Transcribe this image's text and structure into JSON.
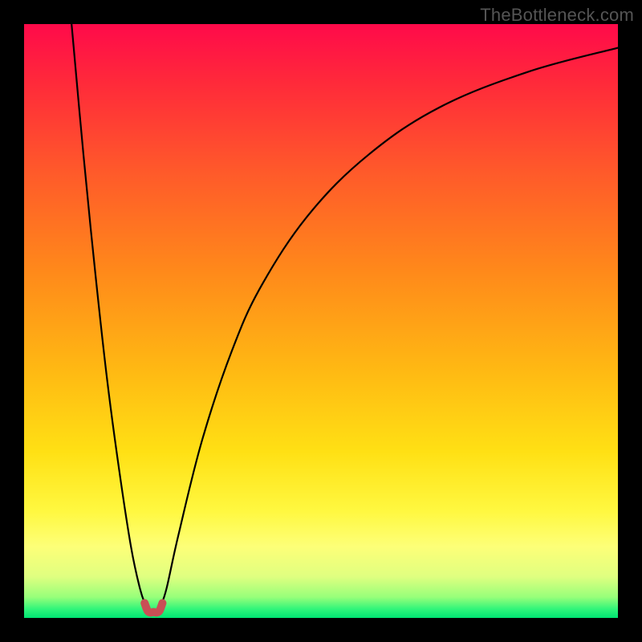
{
  "watermark": "TheBottleneck.com",
  "chart_data": {
    "type": "line",
    "title": "",
    "xlabel": "",
    "ylabel": "",
    "xlim": [
      0,
      100
    ],
    "ylim": [
      0,
      100
    ],
    "series": [
      {
        "name": "left-branch",
        "x": [
          8,
          10,
          12,
          14,
          16,
          18,
          19.5,
          20.5
        ],
        "values": [
          100,
          78,
          58,
          40,
          25,
          12,
          5,
          2
        ]
      },
      {
        "name": "right-branch",
        "x": [
          23,
          24,
          26,
          30,
          35,
          40,
          48,
          58,
          70,
          85,
          100
        ],
        "values": [
          2,
          5,
          14,
          30,
          45,
          56,
          68,
          78,
          86,
          92,
          96
        ]
      },
      {
        "name": "bottom-arc",
        "x": [
          20.3,
          20.8,
          21.3,
          21.8,
          22.3,
          22.8,
          23.3
        ],
        "values": [
          2.5,
          1.2,
          0.9,
          1.0,
          0.9,
          1.2,
          2.5
        ]
      }
    ],
    "gradient_stops": [
      {
        "offset": 0.0,
        "color": "#ff0a4a"
      },
      {
        "offset": 0.1,
        "color": "#ff2a3a"
      },
      {
        "offset": 0.25,
        "color": "#ff5a2a"
      },
      {
        "offset": 0.42,
        "color": "#ff8a1a"
      },
      {
        "offset": 0.58,
        "color": "#ffb813"
      },
      {
        "offset": 0.72,
        "color": "#ffe014"
      },
      {
        "offset": 0.82,
        "color": "#fff840"
      },
      {
        "offset": 0.88,
        "color": "#fdff78"
      },
      {
        "offset": 0.93,
        "color": "#e0ff80"
      },
      {
        "offset": 0.965,
        "color": "#97ff7a"
      },
      {
        "offset": 0.985,
        "color": "#30f57a"
      },
      {
        "offset": 1.0,
        "color": "#00e472"
      }
    ],
    "arc_color": "#c94f55",
    "curve_color": "#000000"
  }
}
